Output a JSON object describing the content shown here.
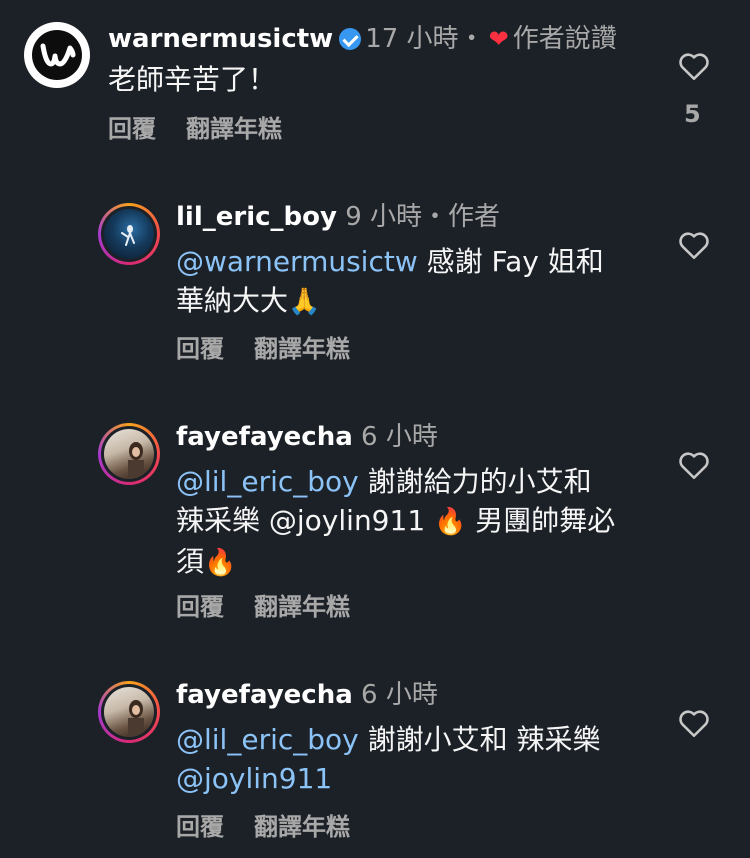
{
  "comments": [
    {
      "username": "warnermusictw",
      "time": "17 小時",
      "separator": "・",
      "author_liked_label": "作者說讚",
      "text": "老師辛苦了！",
      "reply_label": "回覆",
      "translate_label": "翻譯年糕",
      "like_count": "5",
      "avatar_icon": "warner-music-logo-icon"
    },
    {
      "username": "lil_eric_boy",
      "time": "9 小時",
      "separator": "・",
      "author_label": "作者",
      "mention": "@warnermusictw",
      "text_line1": " 感謝 Fay 姐和",
      "text_line2": "華納大大",
      "emoji": "🙏",
      "reply_label": "回覆",
      "translate_label": "翻譯年糕"
    },
    {
      "username": "fayefayecha",
      "time": "6 小時",
      "mention": "@lil_eric_boy",
      "text_line1": " 謝謝給力的小艾和",
      "text_line2_a": "辣采樂 @joylin911 ",
      "emoji1": "🔥",
      "text_line2_b": " 男團帥舞必",
      "text_line3": "須",
      "emoji2": "🔥",
      "reply_label": "回覆",
      "translate_label": "翻譯年糕"
    },
    {
      "username": "fayefayecha",
      "time": "6 小時",
      "mention": "@lil_eric_boy",
      "text_line1": " 謝謝小艾和 辣采樂",
      "mention2": "@joylin911",
      "reply_label": "回覆",
      "translate_label": "翻譯年糕"
    }
  ],
  "colors": {
    "background": "#1c2127",
    "mention": "#8cc3f7",
    "verified": "#3897f0",
    "heart": "#ff3040"
  }
}
